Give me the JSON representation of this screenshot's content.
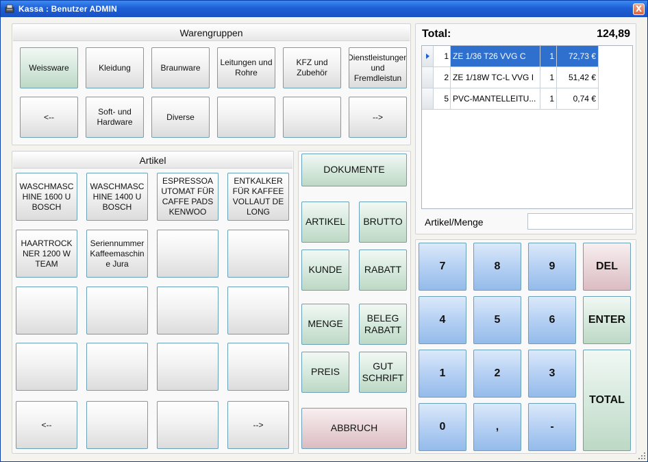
{
  "window": {
    "title": "Kassa : Benutzer ADMIN",
    "close_label": "X"
  },
  "warengruppen": {
    "header": "Warengruppen",
    "buttons": [
      "Weissware",
      "Kleidung",
      "Braunware",
      "Leitungen und Rohre",
      "KFZ und Zubehör",
      "Dienstleistungen und Fremdleistun",
      "<--",
      "Soft- und Hardware",
      "Diverse",
      "",
      "",
      "-->"
    ]
  },
  "artikel": {
    "header": "Artikel",
    "buttons": [
      "WASCHMASCHINE 1600 U BOSCH",
      "WASCHMASCHINE 1400 U BOSCH",
      "ESPRESSOAUTOMAT FÜR CAFFE PADS KENWOO",
      "ENTKALKER FÜR KAFFEEVOLLAUT DELONG",
      "HAARTROCKNER 1200 W TEAM",
      "Seriennummer Kaffeemaschine Jura",
      "",
      "",
      "",
      "",
      "",
      "",
      "",
      "",
      "",
      "",
      "<--",
      "",
      "",
      "-->"
    ]
  },
  "functions": {
    "dokumente": "DOKUMENTE",
    "artikel": "ARTIKEL",
    "brutto": "BRUTTO",
    "kunde": "KUNDE",
    "rabatt": "RABATT",
    "menge": "MENGE",
    "beleg_rabatt": "BELEG RABATT",
    "preis": "PREIS",
    "gutschrift": "GUT SCHRIFT",
    "abbruch": "ABBRUCH"
  },
  "receipt": {
    "total_label": "Total:",
    "total_value": "124,89",
    "rows": [
      {
        "no": "1",
        "name": "ZE 1/36 T26 VVG C",
        "qty": "1",
        "price": "72,73 €",
        "selected": true
      },
      {
        "no": "2",
        "name": "ZE 1/18W TC-L VVG I",
        "qty": "1",
        "price": "51,42 €",
        "selected": false
      },
      {
        "no": "5",
        "name": "PVC-MANTELLEITU...",
        "qty": "1",
        "price": "0,74 €",
        "selected": false
      }
    ],
    "input_label": "Artikel/Menge",
    "input_value": ""
  },
  "keypad": {
    "k7": "7",
    "k8": "8",
    "k9": "9",
    "del": "DEL",
    "k4": "4",
    "k5": "5",
    "k6": "6",
    "enter": "ENTER",
    "k1": "1",
    "k2": "2",
    "k3": "3",
    "total": "TOTAL",
    "k0": "0",
    "comma": ",",
    "minus": "-"
  },
  "colors": {
    "title_bar": "#1f5fd6",
    "selection": "#2f6fce",
    "key_blue": "#b5d0f3",
    "green": "#d9ebe0",
    "pink": "#ebd8db"
  }
}
